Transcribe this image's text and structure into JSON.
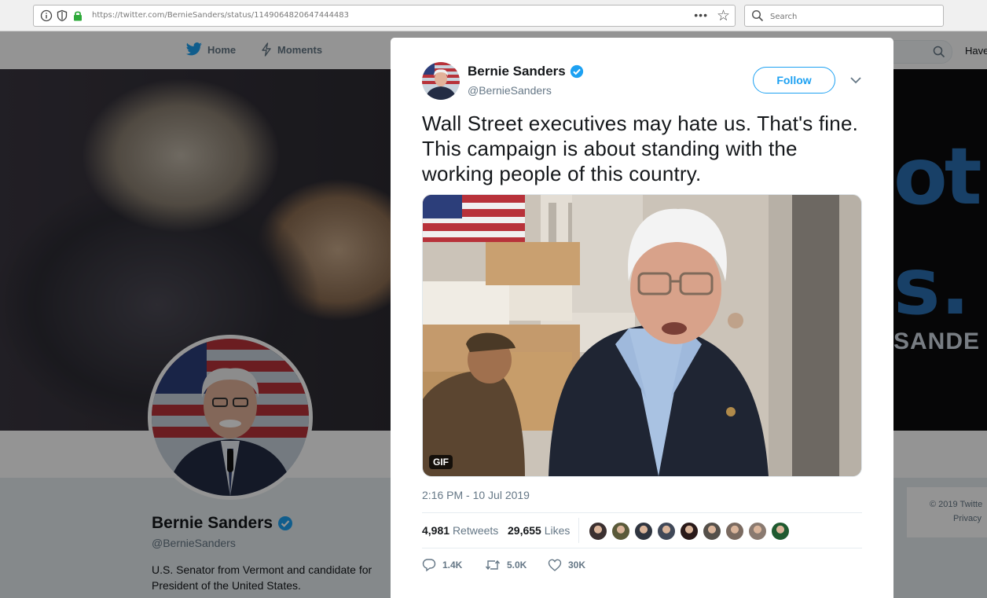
{
  "browser": {
    "url": "https://twitter.com/BernieSanders/status/1149064820647444483",
    "search_placeholder": "Search",
    "more_glyph": "•••"
  },
  "nav": {
    "home": "Home",
    "moments": "Moments",
    "have_partial": "Have"
  },
  "banner": {
    "text_line1": "ot",
    "text_line2": "s.",
    "text_line3": "SANDE"
  },
  "profile": {
    "name": "Bernie Sanders",
    "handle": "@BernieSanders",
    "bio": "U.S. Senator from Vermont and candidate for President of the United States."
  },
  "footer": {
    "copyright": "© 2019 Twitte",
    "privacy": "Privacy"
  },
  "tweet": {
    "author_name": "Bernie Sanders",
    "author_handle": "@BernieSanders",
    "follow_label": "Follow",
    "text": "Wall Street executives may hate us. That's fine. This campaign is about standing with the working people of this country.",
    "media_badge": "GIF",
    "timestamp": "2:16 PM - 10 Jul 2019",
    "retweets_count": "4,981",
    "retweets_label": "Retweets",
    "likes_count": "29,655",
    "likes_label": "Likes",
    "reply_count": "1.4K",
    "retweet_action_count": "5.0K",
    "like_action_count": "30K",
    "liker_colors": [
      "#3b3030",
      "#5a5a3a",
      "#2f3540",
      "#404858",
      "#2a1a1a",
      "#55504a",
      "#7a6a60",
      "#8a7a70",
      "#1f5a30"
    ]
  },
  "colors": {
    "twitter_blue": "#1da1f2",
    "verified": "#1da1f2",
    "lock_green": "#2eaa3a"
  }
}
